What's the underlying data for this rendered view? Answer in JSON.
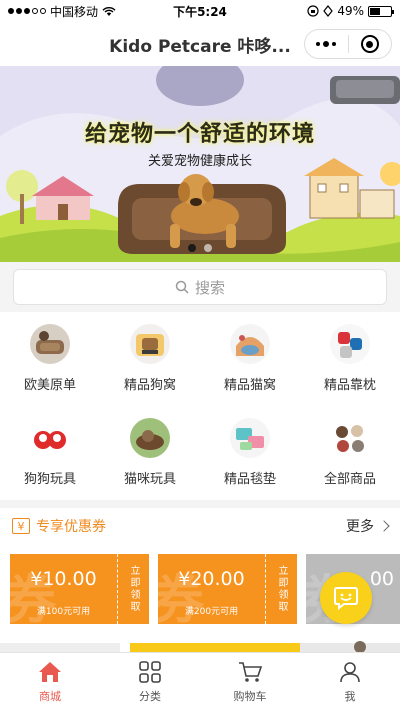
{
  "status_bar": {
    "carrier": "中国移动",
    "time": "下午5:24",
    "battery": "49%",
    "battery_level": 0.49
  },
  "nav": {
    "title": "Kido Petcare 咔哆..."
  },
  "banner": {
    "headline": "给宠物一个舒适的环境",
    "subtitle": "关爱宠物健康成长",
    "slide_count": 2,
    "active_slide": 1
  },
  "search": {
    "placeholder": "搜索"
  },
  "categories": [
    {
      "label": "欧美原单",
      "icon": "dog-bed-thumbnail"
    },
    {
      "label": "精品狗窝",
      "icon": "dog-bed-thumbnail"
    },
    {
      "label": "精品猫窝",
      "icon": "cat-bed-thumbnail"
    },
    {
      "label": "精品靠枕",
      "icon": "pillow-thumbnail"
    },
    {
      "label": "狗狗玩具",
      "icon": "dog-toy-thumbnail"
    },
    {
      "label": "猫咪玩具",
      "icon": "cat-toy-thumbnail"
    },
    {
      "label": "精品毯垫",
      "icon": "blanket-thumbnail"
    },
    {
      "label": "全部商品",
      "icon": "all-products-thumbnail"
    }
  ],
  "coupons": {
    "title": "专享优惠券",
    "more": "更多",
    "yen_symbol": "¥",
    "watermark": "券",
    "items": [
      {
        "amount": "¥10.00",
        "condition": "满100元可用",
        "action": "立即领取"
      },
      {
        "amount": "¥20.00",
        "condition": "满200元可用",
        "action": "立即领取"
      },
      {
        "amount": "00",
        "condition": "",
        "action": ""
      }
    ]
  },
  "tabbar": [
    {
      "label": "商城",
      "icon": "home-icon",
      "active": true
    },
    {
      "label": "分类",
      "icon": "category-icon",
      "active": false
    },
    {
      "label": "购物车",
      "icon": "cart-icon",
      "active": false
    },
    {
      "label": "我",
      "icon": "profile-icon",
      "active": false
    }
  ],
  "colors": {
    "accent": "#e85a4f",
    "coupon": "#f6921e",
    "service": "#f9d01a"
  }
}
